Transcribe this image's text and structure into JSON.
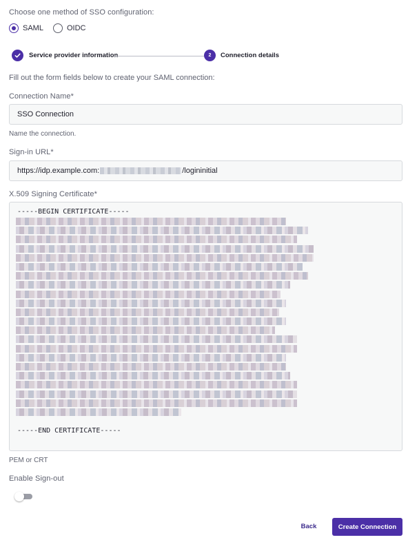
{
  "sso": {
    "method_prompt": "Choose one method of SSO configuration:",
    "methods": [
      {
        "label": "SAML",
        "selected": true
      },
      {
        "label": "OIDC",
        "selected": false
      }
    ]
  },
  "stepper": {
    "steps": [
      {
        "label": "Service provider information",
        "status": "complete",
        "icon": "check-icon"
      },
      {
        "label": "Connection details",
        "status": "current",
        "number": "2"
      }
    ],
    "accent_color": "#4b2fa7"
  },
  "form": {
    "intro": "Fill out the form fields below to create your SAML connection:",
    "connection_name": {
      "label": "Connection Name",
      "required_mark": "*",
      "value": "SSO Connection",
      "helper": "Name the connection."
    },
    "sign_in_url": {
      "label": "Sign-in URL",
      "required_mark": "*",
      "value_prefix": "https://idp.example.com:",
      "value_suffix": "/logininitial"
    },
    "certificate": {
      "label": "X.509 Signing Certificate",
      "required_mark": "*",
      "begin": "-----BEGIN CERTIFICATE-----",
      "end": "-----END CERTIFICATE-----",
      "helper": "PEM or CRT"
    },
    "sign_out": {
      "label": "Enable Sign-out",
      "enabled": false
    }
  },
  "actions": {
    "back_label": "Back",
    "create_label": "Create Connection"
  }
}
